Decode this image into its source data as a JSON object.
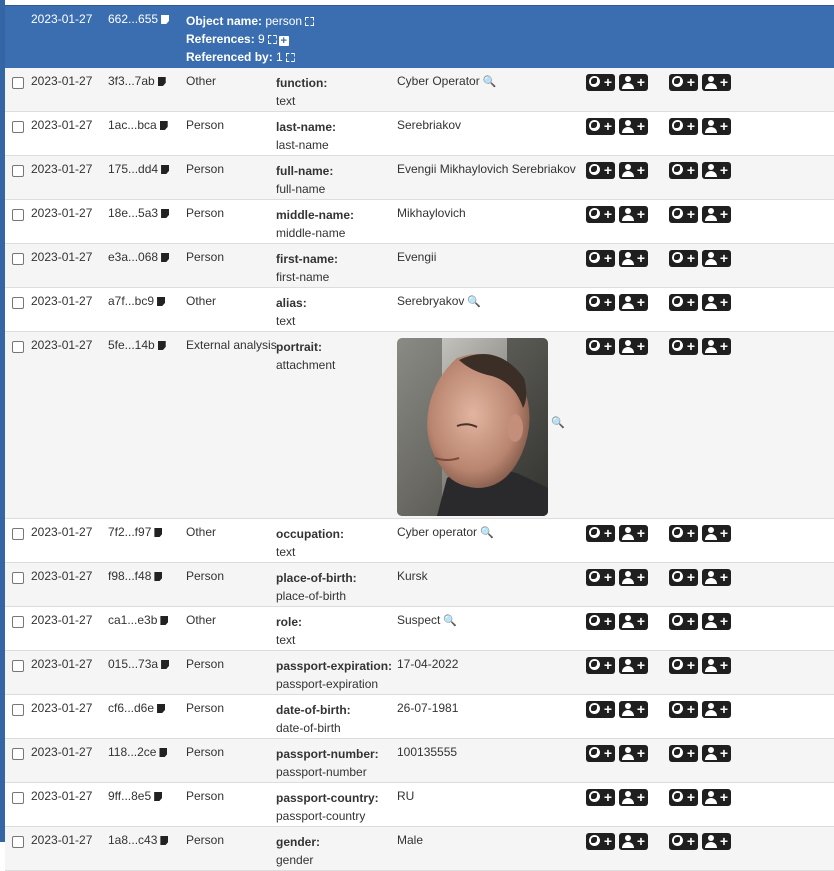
{
  "header": {
    "date": "2023-01-27",
    "id": "662...655",
    "object_name_label": "Object name:",
    "object_name_value": "person",
    "references_label": "References:",
    "references_value": "9",
    "referenced_by_label": "Referenced by:",
    "referenced_by_value": "1"
  },
  "icons": {
    "magnify": "🔍",
    "plus": "+"
  },
  "rows": [
    {
      "date": "2023-01-27",
      "id": "3f3...7ab",
      "category": "Other",
      "relation": "function:",
      "type": "text",
      "value": "Cyber Operator",
      "magnify": true
    },
    {
      "date": "2023-01-27",
      "id": "1ac...bca",
      "category": "Person",
      "relation": "last-name:",
      "type": "last-name",
      "value": "Serebriakov",
      "magnify": false
    },
    {
      "date": "2023-01-27",
      "id": "175...dd4",
      "category": "Person",
      "relation": "full-name:",
      "type": "full-name",
      "value": "Evengii Mikhaylovich Serebriakov",
      "magnify": false
    },
    {
      "date": "2023-01-27",
      "id": "18e...5a3",
      "category": "Person",
      "relation": "middle-name:",
      "type": "middle-name",
      "value": "Mikhaylovich",
      "magnify": false
    },
    {
      "date": "2023-01-27",
      "id": "e3a...068",
      "category": "Person",
      "relation": "first-name:",
      "type": "first-name",
      "value": "Evengii",
      "magnify": false
    },
    {
      "date": "2023-01-27",
      "id": "a7f...bc9",
      "category": "Other",
      "relation": "alias:",
      "type": "text",
      "value": "Serebryakov",
      "magnify": true
    },
    {
      "date": "2023-01-27",
      "id": "5fe...14b",
      "category": "External analysis",
      "relation": "portrait:",
      "type": "attachment",
      "value": "",
      "magnify": true,
      "image": true
    },
    {
      "date": "2023-01-27",
      "id": "7f2...f97",
      "category": "Other",
      "relation": "occupation:",
      "type": "text",
      "value": "Cyber operator",
      "magnify": true
    },
    {
      "date": "2023-01-27",
      "id": "f98...f48",
      "category": "Person",
      "relation": "place-of-birth:",
      "type": "place-of-birth",
      "value": "Kursk",
      "magnify": false
    },
    {
      "date": "2023-01-27",
      "id": "ca1...e3b",
      "category": "Other",
      "relation": "role:",
      "type": "text",
      "value": "Suspect",
      "magnify": true
    },
    {
      "date": "2023-01-27",
      "id": "015...73a",
      "category": "Person",
      "relation": "passport-expiration:",
      "type": "passport-expiration",
      "value": "17-04-2022",
      "magnify": false
    },
    {
      "date": "2023-01-27",
      "id": "cf6...d6e",
      "category": "Person",
      "relation": "date-of-birth:",
      "type": "date-of-birth",
      "value": "26-07-1981",
      "magnify": false
    },
    {
      "date": "2023-01-27",
      "id": "118...2ce",
      "category": "Person",
      "relation": "passport-number:",
      "type": "passport-number",
      "value": "100135555",
      "magnify": false
    },
    {
      "date": "2023-01-27",
      "id": "9ff...8e5",
      "category": "Person",
      "relation": "passport-country:",
      "type": "passport-country",
      "value": "RU",
      "magnify": false
    },
    {
      "date": "2023-01-27",
      "id": "1a8...c43",
      "category": "Person",
      "relation": "gender:",
      "type": "gender",
      "value": "Male",
      "magnify": false
    }
  ]
}
